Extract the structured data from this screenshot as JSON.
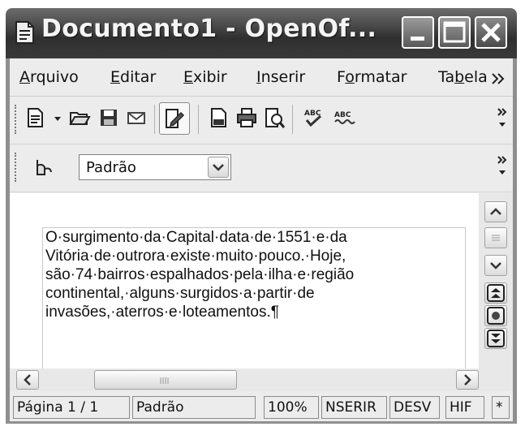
{
  "window": {
    "title": "Documento1 - OpenOf..."
  },
  "menu": {
    "items": [
      {
        "label": "Arquivo",
        "accel": "A"
      },
      {
        "label": "Editar",
        "accel": "E"
      },
      {
        "label": "Exibir",
        "accel": "E"
      },
      {
        "label": "Inserir",
        "accel": "I"
      },
      {
        "label": "Formatar",
        "accel": "o"
      },
      {
        "label": "Tabela",
        "accel": "b"
      }
    ]
  },
  "formatting": {
    "paragraph_style": "Padrão"
  },
  "document": {
    "lines": [
      "O·surgimento·da·Capital·data·de·1551·e·da",
      "Vitória·de·outrora·existe·muito·pouco.·Hoje,",
      "são·74·bairros·espalhados·pela·ilha·e·região",
      "continental,·alguns·surgidos·a·partir·de",
      "invasões,·aterros·e·loteamentos.¶"
    ]
  },
  "status": {
    "page": "Página 1 / 1",
    "style": "Padrão",
    "zoom": "100%",
    "insert_mode": "NSERIR",
    "selection_mode": "DESV",
    "hyphenation": "HIF",
    "modified": "*"
  },
  "icons": {
    "standard_toolbar": [
      "new-document-icon",
      "dropdown-arrow-icon",
      "open-folder-icon",
      "save-icon",
      "email-icon",
      "edit-file-icon",
      "export-pdf-icon",
      "print-icon",
      "page-preview-icon",
      "spellcheck-icon",
      "autospellcheck-icon",
      "toolbar-overflow-icon"
    ],
    "formatting_toolbar": [
      "styles-formatting-icon",
      "combo-dropdown-icon",
      "toolbar-overflow-icon"
    ],
    "vertical_scroll": [
      "scroll-up-icon",
      "scroll-down-icon",
      "previous-page-icon",
      "navigator-icon",
      "next-page-icon"
    ],
    "horizontal_scroll": [
      "scroll-left-icon",
      "scroll-right-icon"
    ]
  }
}
